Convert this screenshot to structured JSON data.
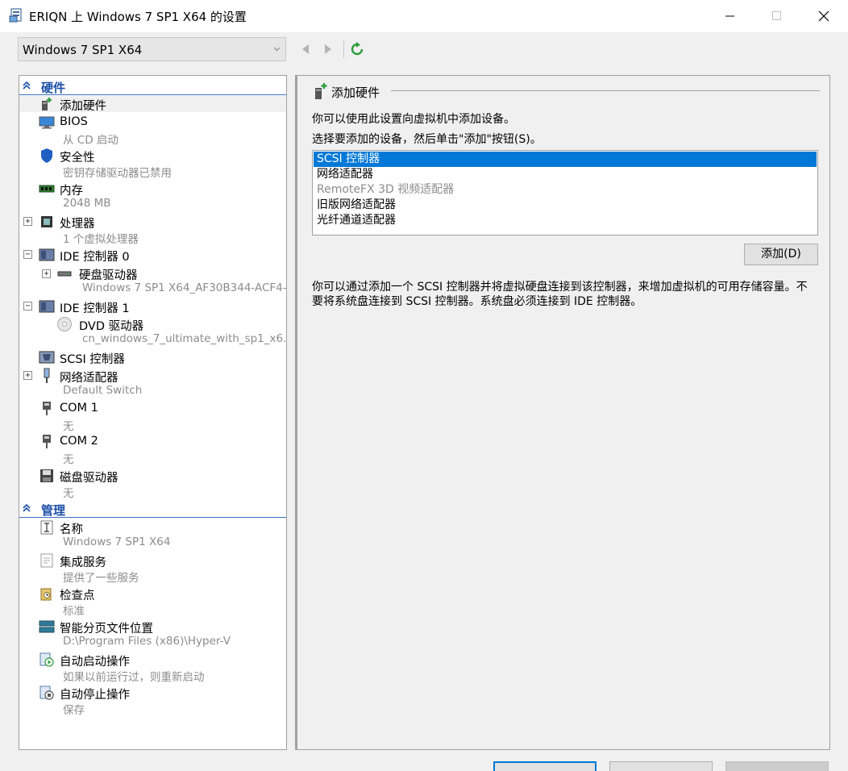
{
  "window": {
    "title": "ERIQN 上 Windows 7 SP1 X64 的设置"
  },
  "toolbar": {
    "vm_selected": "Windows 7 SP1 X64"
  },
  "tree": {
    "hardware_header": "硬件",
    "management_header": "管理",
    "items": [
      {
        "label": "添加硬件",
        "sub": ""
      },
      {
        "label": "BIOS",
        "sub": "从 CD 启动"
      },
      {
        "label": "安全性",
        "sub": "密钥存储驱动器已禁用"
      },
      {
        "label": "内存",
        "sub": "2048 MB"
      },
      {
        "label": "处理器",
        "sub": "1 个虚拟处理器"
      },
      {
        "label": "IDE 控制器 0",
        "sub": ""
      },
      {
        "label": "硬盘驱动器",
        "sub": "Windows 7 SP1 X64_AF30B344-ACF4-..."
      },
      {
        "label": "IDE 控制器 1",
        "sub": ""
      },
      {
        "label": "DVD 驱动器",
        "sub": "cn_windows_7_ultimate_with_sp1_x6..."
      },
      {
        "label": "SCSI 控制器",
        "sub": ""
      },
      {
        "label": "网络适配器",
        "sub": "Default Switch"
      },
      {
        "label": "COM 1",
        "sub": "无"
      },
      {
        "label": "COM 2",
        "sub": "无"
      },
      {
        "label": "磁盘驱动器",
        "sub": "无"
      }
    ],
    "management": [
      {
        "label": "名称",
        "sub": "Windows 7 SP1 X64"
      },
      {
        "label": "集成服务",
        "sub": "提供了一些服务"
      },
      {
        "label": "检查点",
        "sub": "标准"
      },
      {
        "label": "智能分页文件位置",
        "sub": "D:\\Program Files (x86)\\Hyper-V"
      },
      {
        "label": "自动启动操作",
        "sub": "如果以前运行过，则重新启动"
      },
      {
        "label": "自动停止操作",
        "sub": "保存"
      }
    ]
  },
  "panel": {
    "title": "添加硬件",
    "intro": "你可以使用此设置向虚拟机中添加设备。",
    "instruction": "选择要添加的设备，然后单击\"添加\"按钮(S)。",
    "devices": [
      "SCSI 控制器",
      "网络适配器",
      "RemoteFX 3D 视频适配器",
      "旧版网络适配器",
      "光纤通道适配器"
    ],
    "add_button": "添加(D)",
    "description": "你可以通过添加一个 SCSI 控制器并将虚拟硬盘连接到该控制器，来增加虚拟机的可用存储容量。不要将系统盘连接到 SCSI 控制器。系统盘必须连接到 IDE 控制器。"
  },
  "colors": {
    "accent": "#0078d7",
    "section_header": "#1c4fa8",
    "refresh_green": "#2e9e3e"
  }
}
